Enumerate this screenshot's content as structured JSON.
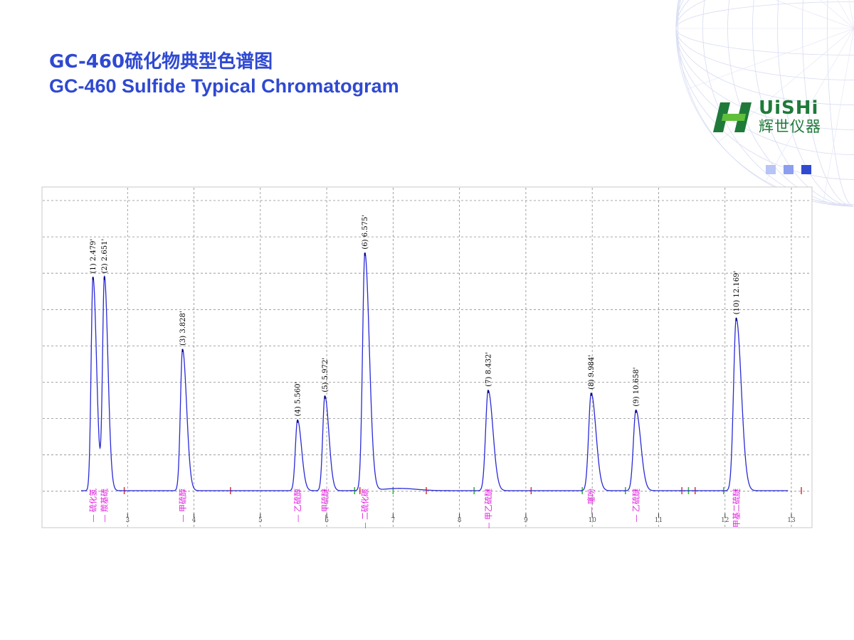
{
  "header": {
    "title_cn": "GC-460硫化物典型色谱图",
    "title_en": "GC-460 Sulfide Typical Chromatogram"
  },
  "logo": {
    "brand": "UiSHi",
    "subtitle": "辉世仪器"
  },
  "colors": {
    "title": "#2f49d1",
    "trace": "#2a2ad6",
    "peak_label": "#000000",
    "compound_label": "#e020e0",
    "grid": "#8c8c8c",
    "logo_green": "#1f7a3a",
    "dot_light": "#b8c4f5",
    "dot_mid": "#8d9ef0",
    "dot_dark": "#2f49d1"
  },
  "decor_dots": [
    "dot_light",
    "dot_mid",
    "dot_dark"
  ],
  "chart_data": {
    "type": "line",
    "title": "",
    "xlabel": "",
    "ylabel": "",
    "xlim": [
      1.7,
      13.3
    ],
    "ylim": [
      0,
      1.0
    ],
    "x_ticks": [
      3,
      4,
      5,
      6,
      7,
      8,
      9,
      10,
      11,
      12,
      13
    ],
    "grid": true,
    "peaks": [
      {
        "label": "(1) 2.479'",
        "rt": 2.479,
        "height": 0.755,
        "width": 0.028,
        "compound": "硫化氢"
      },
      {
        "label": "(2) 2.651'",
        "rt": 2.651,
        "height": 0.755,
        "width": 0.028,
        "compound": "羰基硫"
      },
      {
        "label": "(3) 3.828'",
        "rt": 3.828,
        "height": 0.5,
        "width": 0.032,
        "compound": "甲硫醇"
      },
      {
        "label": "(4) 5.560'",
        "rt": 5.56,
        "height": 0.25,
        "width": 0.032,
        "compound": "乙硫醇"
      },
      {
        "label": "(5) 5.972'",
        "rt": 5.972,
        "height": 0.335,
        "width": 0.032,
        "compound": "甲硫醚"
      },
      {
        "label": "(6) 6.575'",
        "rt": 6.575,
        "height": 0.84,
        "width": 0.035,
        "compound": "二硫化碳"
      },
      {
        "label": "(7) 8.432'",
        "rt": 8.432,
        "height": 0.355,
        "width": 0.038,
        "compound": "甲乙硫醚"
      },
      {
        "label": "(8) 9.984'",
        "rt": 9.984,
        "height": 0.345,
        "width": 0.038,
        "compound": "噻吩"
      },
      {
        "label": "(9) 10.658'",
        "rt": 10.658,
        "height": 0.285,
        "width": 0.038,
        "compound": "乙硫醚"
      },
      {
        "label": "(10) 12.169'",
        "rt": 12.169,
        "height": 0.61,
        "width": 0.04,
        "compound": "二甲基二硫醚"
      }
    ],
    "baseline_markers": {
      "red": [
        2.95,
        4.55,
        6.5,
        7.5,
        9.08,
        11.35,
        11.55,
        13.15
      ],
      "green": [
        6.42,
        7.0,
        8.22,
        9.85,
        10.5,
        11.45,
        11.98
      ]
    }
  }
}
